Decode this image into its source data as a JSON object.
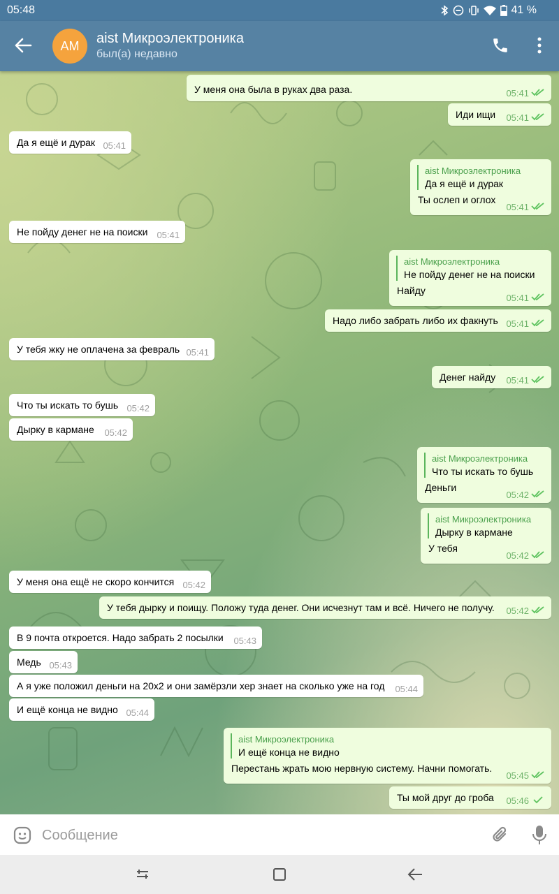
{
  "status_bar": {
    "time": "05:48",
    "battery": "41 %"
  },
  "header": {
    "avatar_initials": "AM",
    "title": "aist Микроэлектроника",
    "subtitle": "был(а) недавно"
  },
  "colors": {
    "header_bg": "#5682a3",
    "incoming_bubble": "#ffffff",
    "outgoing_bubble": "#effdde",
    "reply_accent": "#5bb55c",
    "avatar": "#f5a33d"
  },
  "messages": [
    {
      "dir": "out",
      "text": "У меня она была в руках два раза.",
      "time": "05:41",
      "status": "read"
    },
    {
      "dir": "out",
      "text": "Иди ищи",
      "time": "05:41",
      "status": "read"
    },
    {
      "dir": "in",
      "text": "Да я ещё и дурак",
      "time": "05:41"
    },
    {
      "dir": "out",
      "reply_name": "aist Микроэлектроника",
      "reply_text": "Да я ещё и дурак",
      "text": "Ты ослеп и оглох",
      "time": "05:41",
      "status": "read"
    },
    {
      "dir": "in",
      "text": "Не пойду денег не на поиски",
      "time": "05:41"
    },
    {
      "dir": "out",
      "reply_name": "aist Микроэлектроника",
      "reply_text": "Не пойду денег не на поиски",
      "text": "Найду",
      "time": "05:41",
      "status": "read"
    },
    {
      "dir": "out",
      "text": "Надо либо забрать либо их факнуть",
      "time": "05:41",
      "status": "read"
    },
    {
      "dir": "in",
      "text": "У тебя жку не оплачена за февраль",
      "time": "05:41"
    },
    {
      "dir": "out",
      "text": "Денег найду",
      "time": "05:41",
      "status": "read"
    },
    {
      "dir": "in",
      "text": "Что ты искать то бушь",
      "time": "05:42"
    },
    {
      "dir": "in",
      "text": "Дырку в кармане",
      "time": "05:42"
    },
    {
      "dir": "out",
      "reply_name": "aist Микроэлектроника",
      "reply_text": "Что ты искать то бушь",
      "text": "Деньги",
      "time": "05:42",
      "status": "read"
    },
    {
      "dir": "out",
      "reply_name": "aist Микроэлектроника",
      "reply_text": "Дырку в кармане",
      "text": "У тебя",
      "time": "05:42",
      "status": "read"
    },
    {
      "dir": "in",
      "text": "У меня она ещё не скоро кончится",
      "time": "05:42"
    },
    {
      "dir": "out",
      "text": "У тебя дырку и поищу. Положу туда денег. Они исчезнут там и всё. Ничего не получу.",
      "time": "05:42",
      "status": "read"
    },
    {
      "dir": "in",
      "text": "В 9 почта откроется. Надо забрать 2 посылки",
      "time": "05:43"
    },
    {
      "dir": "in",
      "text": "Медь",
      "time": "05:43"
    },
    {
      "dir": "in",
      "text": "А я уже положил деньги на 20x2 и они замёрзли хер знает на сколько уже на год",
      "time": "05:44"
    },
    {
      "dir": "in",
      "text": "И ещё конца не видно",
      "time": "05:44"
    },
    {
      "dir": "out",
      "reply_name": "aist Микроэлектроника",
      "reply_text": "И ещё конца не видно",
      "text": "Перестань жрать мою нервную систему. Начни помогать.",
      "time": "05:45",
      "status": "read"
    },
    {
      "dir": "out",
      "text": "Ты мой друг до гроба",
      "time": "05:46",
      "status": "sent"
    }
  ],
  "composer": {
    "placeholder": "Сообщение"
  },
  "icons": {
    "status": [
      "bluetooth-icon",
      "dnd-icon",
      "vibrate-icon",
      "wifi-icon",
      "battery-icon"
    ],
    "header": [
      "back-arrow-icon",
      "phone-icon",
      "more-vert-icon"
    ],
    "composer": [
      "emoji-icon",
      "attach-icon",
      "mic-icon"
    ],
    "nav": [
      "recent-apps-icon",
      "home-icon",
      "back-icon"
    ]
  }
}
